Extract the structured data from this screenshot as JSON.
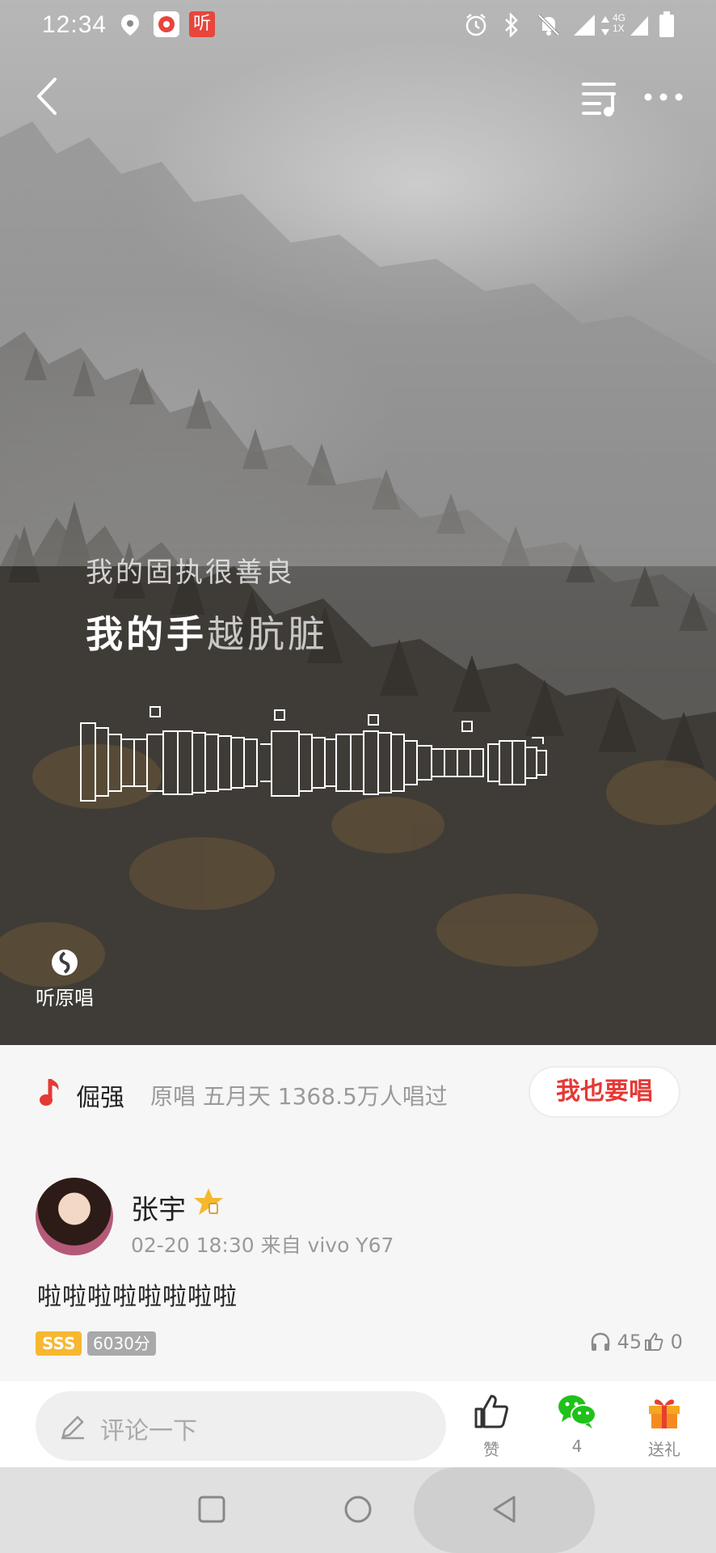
{
  "status_bar": {
    "time": "12:34",
    "app_badge_label": "听",
    "network_label_top": "4G",
    "network_label_bottom": "1X",
    "icons": [
      "location-icon",
      "app-music-icon",
      "app-listen-icon",
      "alarm-icon",
      "bluetooth-icon",
      "mute-bell-icon",
      "signal-icon",
      "data-arrows-icon",
      "battery-icon"
    ]
  },
  "header": {
    "back_icon": "chevron-left-icon",
    "playlist_icon": "playlist-music-icon",
    "more_icon": "more-dots-icon"
  },
  "lyrics": {
    "line_1": "我的固执很善良",
    "line_2_sung": "我的手",
    "line_2_rest": "越肮脏"
  },
  "listen_original": {
    "label": "听原唱",
    "icon": "disc-icon"
  },
  "song": {
    "title": "倔强",
    "meta": "原唱 五月天 1368.5万人唱过",
    "sing_button": "我也要唱",
    "accent_color": "#e53935"
  },
  "post": {
    "user_name": "张宇",
    "timestamp": "02-20 18:30 来自 vivo Y67",
    "text": "啦啦啦啦啦啦啦啦",
    "grade": "SSS",
    "score": "6030分",
    "listen_count": "45",
    "like_count": "0"
  },
  "bottom_bar": {
    "comment_placeholder": "评论一下",
    "like_label": "赞",
    "share_count": "4",
    "gift_label": "送礼"
  },
  "nav": {
    "icons": [
      "recent-apps-icon",
      "home-icon",
      "back-triangle-icon"
    ]
  }
}
